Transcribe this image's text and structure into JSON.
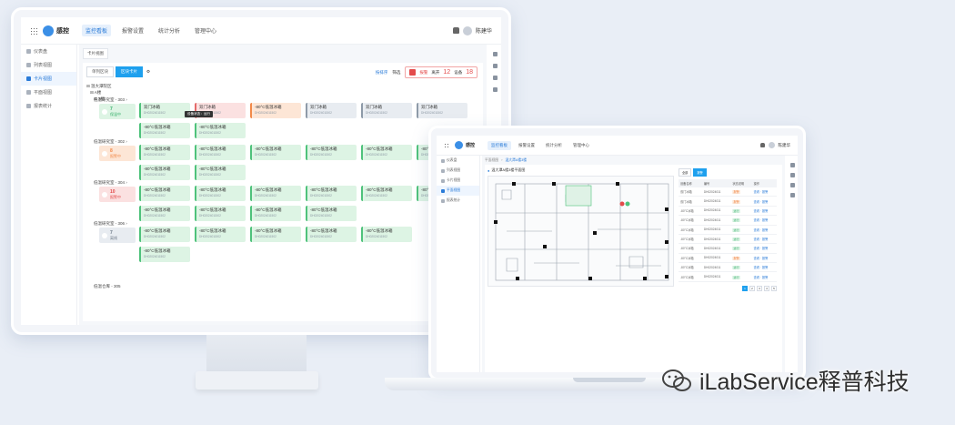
{
  "desktop": {
    "brand": "感控",
    "nav": [
      "监控看板",
      "报警设置",
      "统计分析",
      "管理中心"
    ],
    "user": "陈建华",
    "sidebar": [
      "仪表盘",
      "列表视图",
      "卡片视图",
      "平面视图",
      "报表统计"
    ],
    "breadcrumb_tab": "卡片视图",
    "view_toggle": [
      "单列区块",
      "区块卡片"
    ],
    "sort_label": "按排序",
    "filter_label": "筛选",
    "alarm_label": "报警",
    "alarm_count_label": "离开",
    "alarm_count": "12",
    "fault_label": "设备",
    "fault_count": "18",
    "tree_root": "温大潭院区",
    "tree_building": "A楼",
    "tree_floor": "3楼",
    "rooms": [
      {
        "name": "低温研究室 - 303",
        "count": "7",
        "status": "保温中"
      },
      {
        "name": "低温研究室 - 302",
        "count": "8",
        "status": "报警中"
      },
      {
        "name": "低温研究室 - 304",
        "count": "10",
        "status": "报警中"
      },
      {
        "name": "低温研究室 - 306",
        "count": "7",
        "status": "离线"
      }
    ],
    "last_room": "低温仓库 - 305",
    "tooltip": "设备状态：运行",
    "card_door": "双门冰箱",
    "card_freezer": "-80°C低温冰箱",
    "card_id": "DH02024011502"
  },
  "laptop": {
    "brand": "感控",
    "nav": [
      "监控看板",
      "报警设置",
      "统计分析",
      "管理中心"
    ],
    "user": "陈建华",
    "sidebar": [
      "仪表盘",
      "列表视图",
      "卡片视图",
      "平面视图",
      "报表统计"
    ],
    "crumbs": [
      "平面视图",
      "温大潭A楼3楼"
    ],
    "map_title": "温大潭A楼3楼平面图",
    "tabs": [
      "全部",
      "报警"
    ],
    "table_headers": [
      "设备名称",
      "编号",
      "状态说明",
      "操作"
    ],
    "rows": [
      {
        "name": "双门冰箱",
        "id": "DH02024011",
        "status": "报警",
        "warn": true
      },
      {
        "name": "双门冰箱",
        "id": "DH02024011",
        "status": "报警",
        "warn": true
      },
      {
        "name": "-80°C冰箱",
        "id": "DH02024011",
        "status": "运行",
        "warn": false
      },
      {
        "name": "-80°C冰箱",
        "id": "DH02024011",
        "status": "运行",
        "warn": false
      },
      {
        "name": "-80°C冰箱",
        "id": "DH02024011",
        "status": "运行",
        "warn": false
      },
      {
        "name": "-80°C冰箱",
        "id": "DH02024011",
        "status": "运行",
        "warn": false
      },
      {
        "name": "-80°C冰箱",
        "id": "DH02024011",
        "status": "运行",
        "warn": false
      },
      {
        "name": "-80°C冰箱",
        "id": "DH02024011",
        "status": "报警",
        "warn": true
      },
      {
        "name": "-80°C冰箱",
        "id": "DH02024011",
        "status": "运行",
        "warn": false
      },
      {
        "name": "-80°C冰箱",
        "id": "DH02024011",
        "status": "运行",
        "warn": false
      }
    ],
    "action": "查看 · 报警",
    "pages": [
      "1",
      "2",
      "3",
      "4",
      "5"
    ]
  },
  "watermark": "iLabService释普科技",
  "colors": {
    "accent": "#1ea0ee",
    "green": "#4fc27b",
    "red": "#e46a6a",
    "orange": "#f28a4a",
    "gray": "#8e9aa8"
  }
}
